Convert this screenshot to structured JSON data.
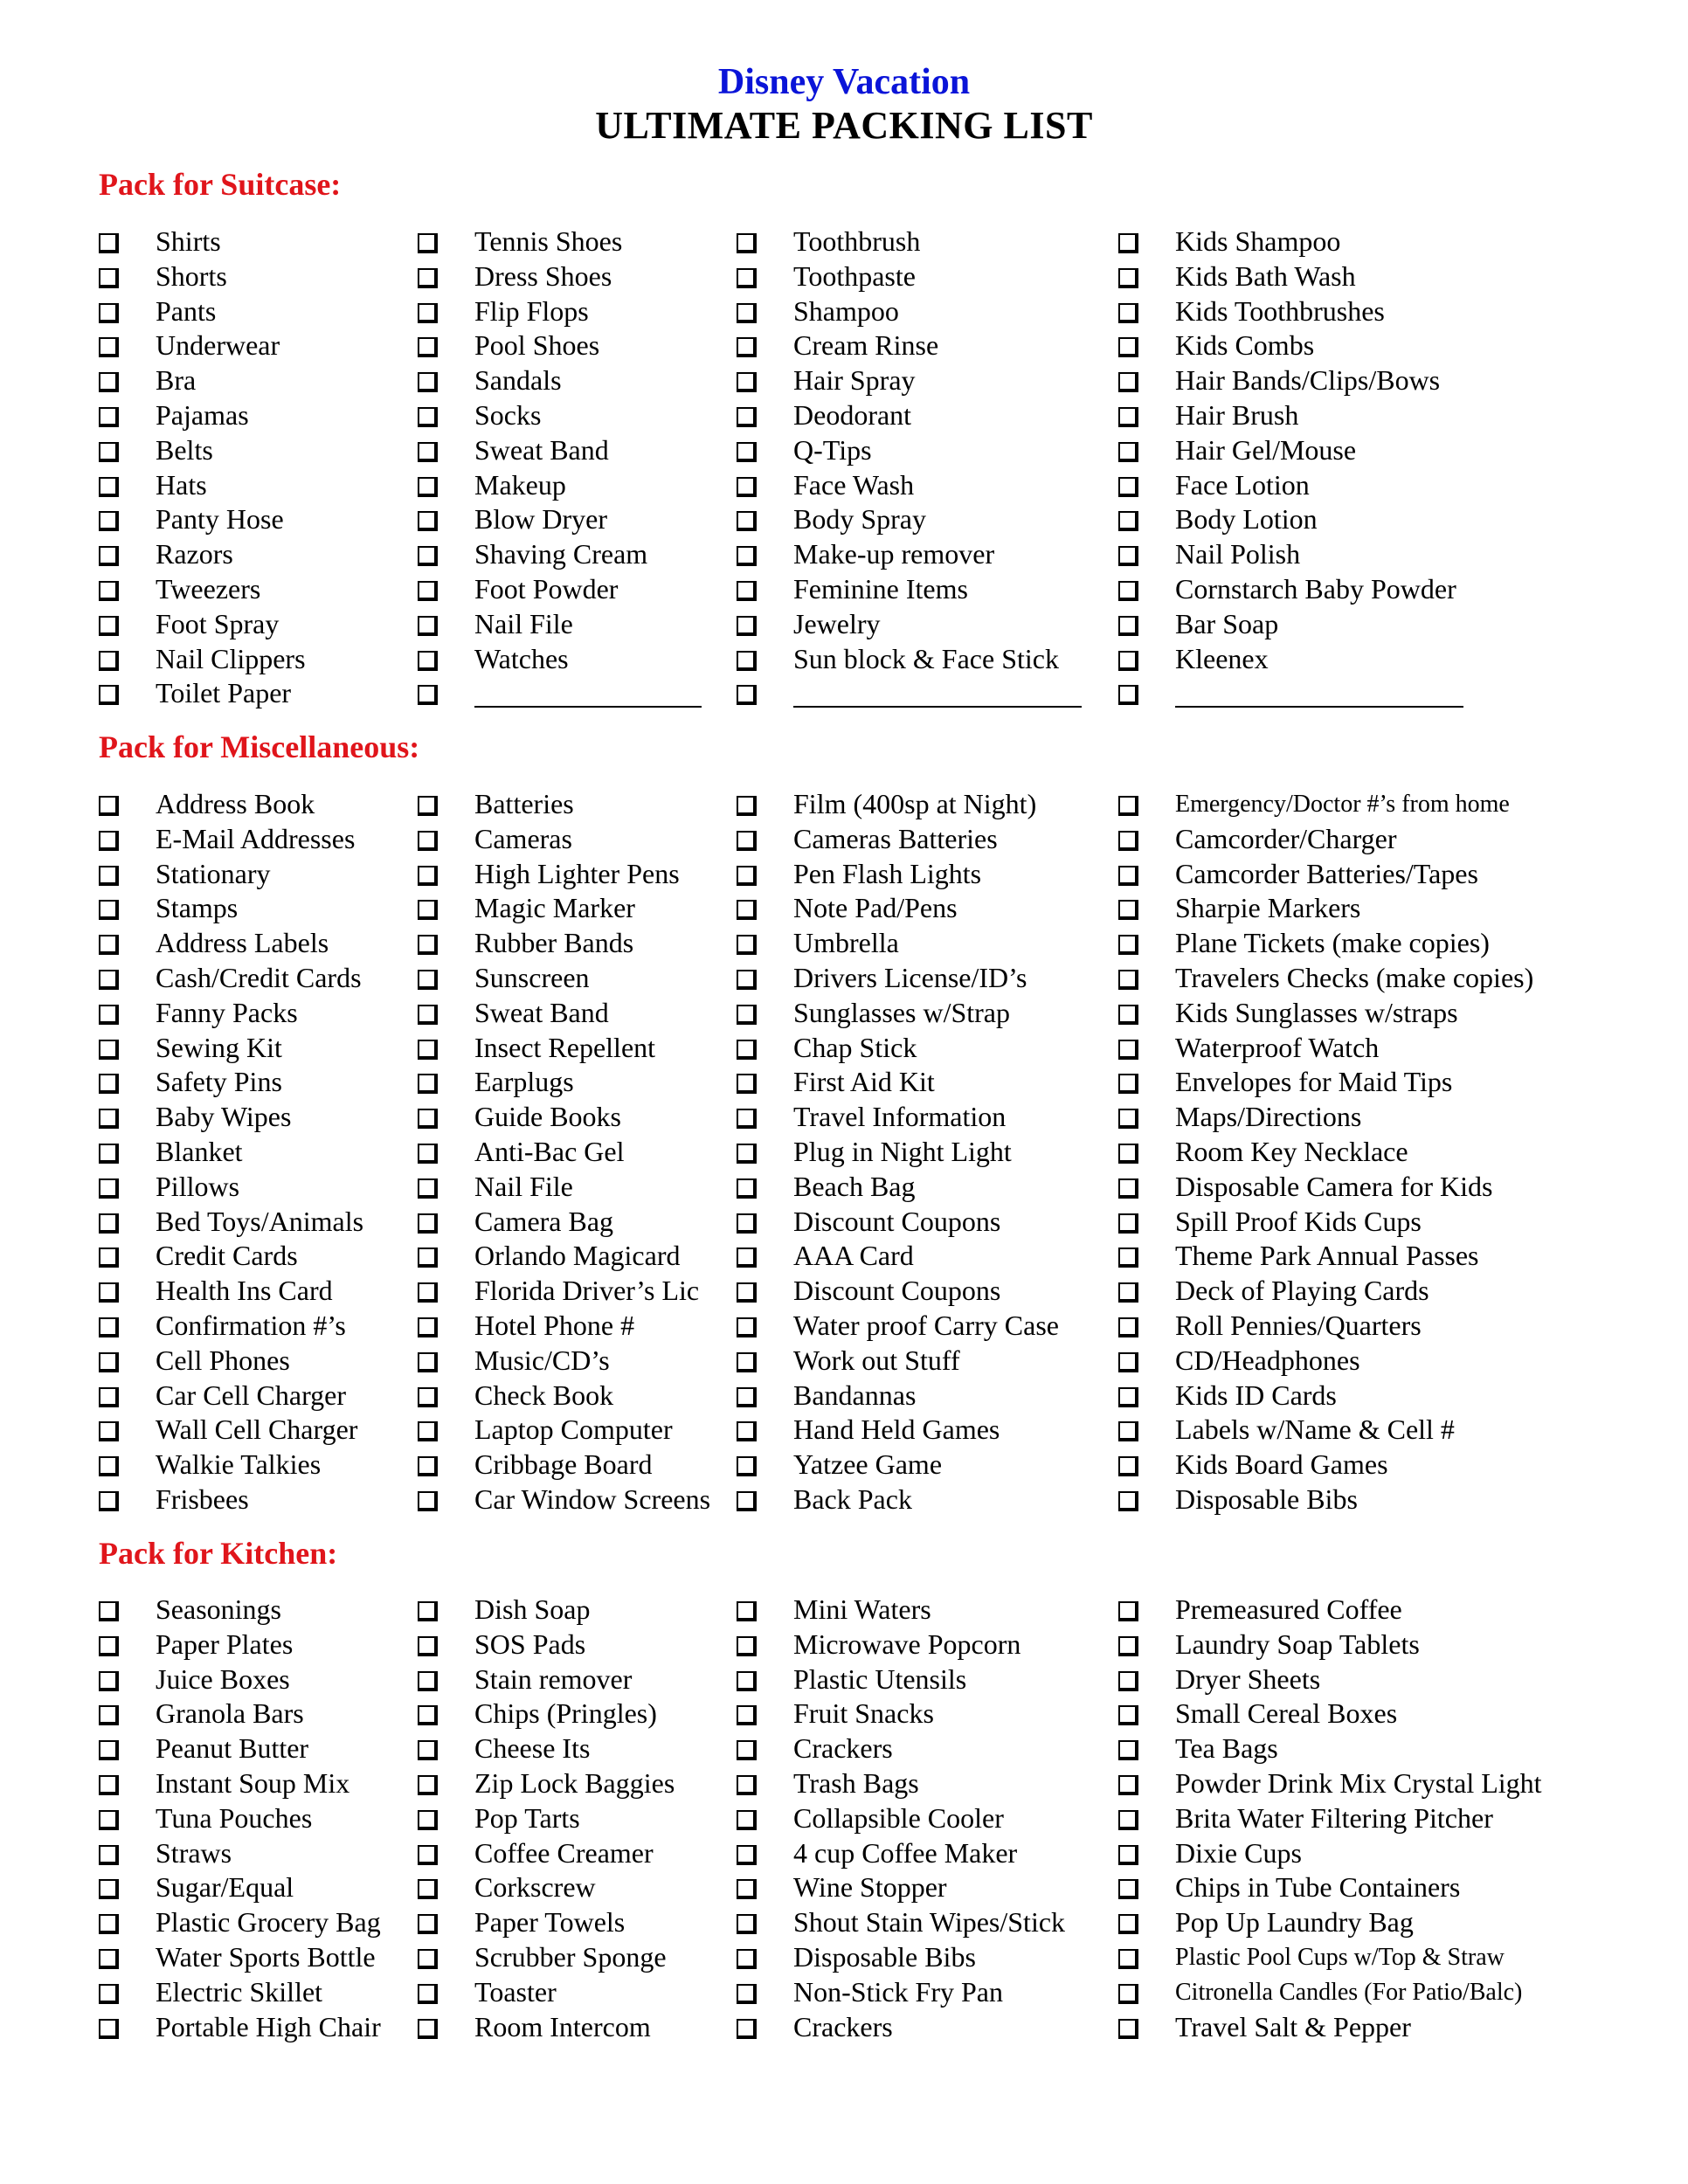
{
  "header": {
    "title": "Disney Vacation",
    "subtitle": "ULTIMATE PACKING LIST"
  },
  "colors": {
    "title": "#0a14d8",
    "subtitle": "#000000",
    "section_heading": "#e0151b",
    "text": "#000000"
  },
  "checkbox_icon": "shadowed-empty-checkbox",
  "sections": [
    {
      "heading": "Pack for Suitcase:",
      "columns": [
        [
          "Shirts",
          "Shorts",
          "Pants",
          "Underwear",
          "Bra",
          "Pajamas",
          "Belts",
          "Hats",
          "Panty Hose",
          "Razors",
          "Tweezers",
          "Foot Spray",
          "Nail Clippers",
          "Toilet Paper"
        ],
        [
          "Tennis Shoes",
          "Dress Shoes",
          "Flip Flops",
          "Pool Shoes",
          "Sandals",
          "Socks",
          "Sweat Band",
          "Makeup",
          "Blow Dryer",
          "Shaving Cream",
          "Foot Powder",
          "Nail File",
          "Watches",
          ""
        ],
        [
          "Toothbrush",
          "Toothpaste",
          "Shampoo",
          "Cream Rinse",
          "Hair Spray",
          "Deodorant",
          "Q-Tips",
          "Face Wash",
          "Body Spray",
          "Make-up remover",
          "Feminine Items",
          "Jewelry",
          "Sun block & Face Stick",
          ""
        ],
        [
          "Kids Shampoo",
          "Kids Bath Wash",
          "Kids Toothbrushes",
          "Kids Combs",
          "Hair Bands/Clips/Bows",
          "Hair Brush",
          "Hair Gel/Mouse",
          "Face Lotion",
          "Body Lotion",
          "Nail Polish",
          "Cornstarch Baby Powder",
          "Bar Soap",
          "Kleenex",
          ""
        ]
      ]
    },
    {
      "heading": "Pack for Miscellaneous:",
      "columns": [
        [
          "Address Book",
          "E-Mail Addresses",
          "Stationary",
          "Stamps",
          "Address Labels",
          "Cash/Credit Cards",
          "Fanny Packs",
          "Sewing Kit",
          "Safety Pins",
          "Baby Wipes",
          "Blanket",
          "Pillows",
          "Bed Toys/Animals",
          "Credit Cards",
          "Health Ins Card",
          "Confirmation #’s",
          "Cell Phones",
          "Car Cell Charger",
          "Wall Cell Charger",
          "Walkie Talkies",
          "Frisbees"
        ],
        [
          "Batteries",
          "Cameras",
          "High Lighter Pens",
          "Magic Marker",
          "Rubber Bands",
          "Sunscreen",
          "Sweat Band",
          "Insect Repellent",
          "Earplugs",
          "Guide Books",
          "Anti-Bac Gel",
          "Nail File",
          "Camera Bag",
          "Orlando Magicard",
          "Florida Driver’s Lic",
          "Hotel Phone #",
          "Music/CD’s",
          "Check Book",
          "Laptop Computer",
          "Cribbage Board",
          "Car Window Screens"
        ],
        [
          "Film (400sp at Night)",
          "Cameras Batteries",
          "Pen Flash Lights",
          "Note Pad/Pens",
          "Umbrella",
          "Drivers License/ID’s",
          "Sunglasses w/Strap",
          "Chap Stick",
          "First Aid Kit",
          "Travel Information",
          "Plug in Night Light",
          "Beach Bag",
          "Discount Coupons",
          "AAA Card",
          "Discount Coupons",
          "Water proof Carry Case",
          "Work out Stuff",
          "Bandannas",
          "Hand Held Games",
          "Yatzee Game",
          "Back Pack"
        ],
        [
          "Emergency/Doctor #’s from home",
          "Camcorder/Charger",
          "Camcorder Batteries/Tapes",
          "Sharpie Markers",
          "Plane Tickets (make copies)",
          "Travelers Checks (make copies)",
          "Kids Sunglasses w/straps",
          "Waterproof Watch",
          "Envelopes for Maid Tips",
          "Maps/Directions",
          "Room Key Necklace",
          "Disposable Camera for Kids",
          "Spill Proof Kids Cups",
          "Theme Park Annual Passes",
          "Deck of Playing Cards",
          "Roll Pennies/Quarters",
          "CD/Headphones",
          "Kids ID Cards",
          "Labels w/Name & Cell #",
          "Kids Board Games",
          "Disposable Bibs"
        ]
      ]
    },
    {
      "heading": "Pack for Kitchen:",
      "columns": [
        [
          "Seasonings",
          "Paper Plates",
          "Juice Boxes",
          "Granola Bars",
          "Peanut Butter",
          "Instant Soup Mix",
          "Tuna Pouches",
          "Straws",
          "Sugar/Equal",
          "Plastic Grocery Bag",
          "Water Sports Bottle",
          "Electric Skillet",
          "Portable High Chair"
        ],
        [
          "Dish Soap",
          "SOS Pads",
          "Stain remover",
          "Chips (Pringles)",
          "Cheese Its",
          "Zip Lock Baggies",
          "Pop Tarts",
          "Coffee Creamer",
          "Corkscrew",
          "Paper Towels",
          "Scrubber Sponge",
          "Toaster",
          "Room Intercom"
        ],
        [
          "Mini Waters",
          "Microwave Popcorn",
          "Plastic Utensils",
          "Fruit Snacks",
          "Crackers",
          "Trash Bags",
          "Collapsible Cooler",
          "4 cup Coffee Maker",
          "Wine Stopper",
          "Shout Stain Wipes/Stick",
          "Disposable Bibs",
          "Non-Stick Fry Pan",
          "Crackers"
        ],
        [
          "Premeasured Coffee",
          "Laundry Soap Tablets",
          "Dryer Sheets",
          "Small Cereal Boxes",
          "Tea Bags",
          "Powder Drink Mix Crystal Light",
          "Brita Water Filtering Pitcher",
          "Dixie Cups",
          "Chips in Tube Containers",
          "Pop Up Laundry Bag",
          "Plastic Pool Cups w/Top & Straw",
          "Citronella Candles (For Patio/Balc)",
          "Travel Salt & Pepper"
        ]
      ]
    }
  ]
}
